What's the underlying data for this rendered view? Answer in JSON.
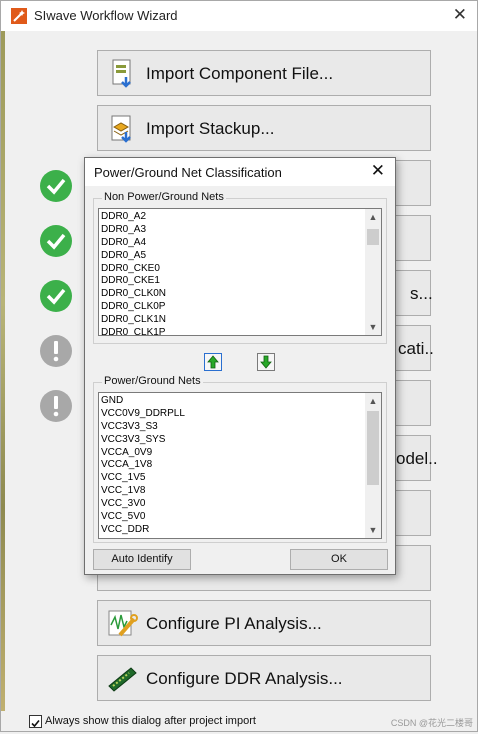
{
  "window": {
    "title": "SIwave Workflow Wizard",
    "close_glyph": "✕"
  },
  "wizard_buttons": [
    {
      "label": "Import Component File...",
      "icon": "component-file-icon"
    },
    {
      "label": "Import Stackup...",
      "icon": "stackup-icon"
    },
    {
      "label": "",
      "icon": ""
    },
    {
      "label": "",
      "icon": ""
    },
    {
      "label": "s...",
      "icon": ""
    },
    {
      "label": "cati..",
      "icon": ""
    },
    {
      "label": "",
      "icon": ""
    },
    {
      "label": "odel..",
      "icon": ""
    },
    {
      "label": "",
      "icon": ""
    },
    {
      "label": "",
      "icon": ""
    },
    {
      "label": "Configure PI Analysis...",
      "icon": "pi-analysis-icon"
    },
    {
      "label": "Configure DDR Analysis...",
      "icon": "ddr-chip-icon"
    }
  ],
  "status_icons": [
    "check-icon",
    "check-icon",
    "check-icon",
    "warning-icon",
    "warning-icon"
  ],
  "footer": {
    "checkbox_label": "Always show this dialog after project import",
    "checkbox_checked": true,
    "watermark": "CSDN @花光二楼哥"
  },
  "dialog": {
    "title": "Power/Ground Net Classification",
    "close_glyph": "✕",
    "non_pg_label": "Non Power/Ground Nets",
    "non_pg_nets": [
      "DDR0_A2",
      "DDR0_A3",
      "DDR0_A4",
      "DDR0_A5",
      "DDR0_CKE0",
      "DDR0_CKE1",
      "DDR0_CLK0N",
      "DDR0_CLK0P",
      "DDR0_CLK1N",
      "DDR0_CLK1P"
    ],
    "pg_label": "Power/Ground Nets",
    "pg_nets": [
      "GND",
      "VCC0V9_DDRPLL",
      "VCC3V3_S3",
      "VCC3V3_SYS",
      "VCCA_0V9",
      "VCCA_1V8",
      "VCC_1V5",
      "VCC_1V8",
      "VCC_3V0",
      "VCC_5V0",
      "VCC_DDR"
    ],
    "auto_identify_label": "Auto Identify",
    "ok_label": "OK",
    "move_up_icon": "green-up-arrow-icon",
    "move_down_icon": "green-down-arrow-icon"
  }
}
